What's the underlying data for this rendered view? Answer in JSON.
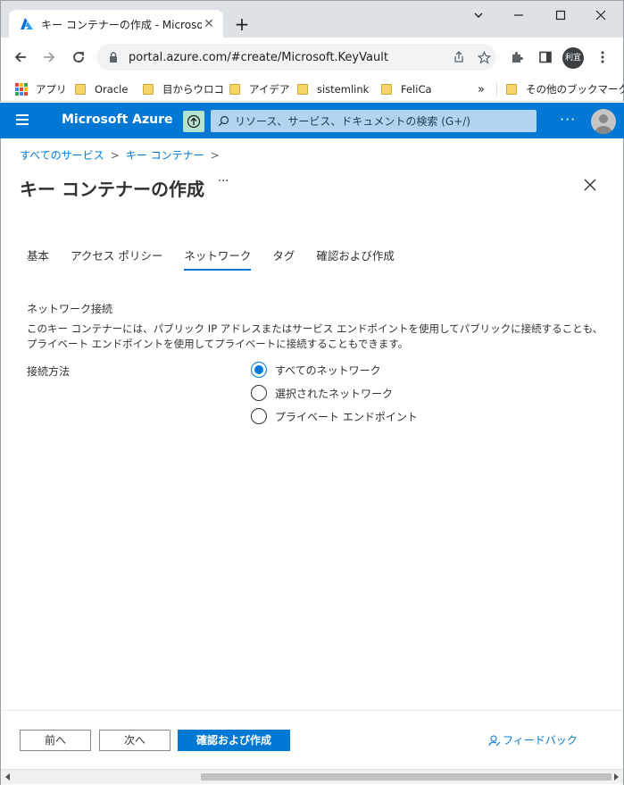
{
  "browser": {
    "tab_title": "キー コンテナーの作成 - Microsoft Az",
    "url": "portal.azure.com/#create/Microsoft.KeyVault",
    "profile_initials": "利宜",
    "bookmarks": [
      {
        "label": "アプリ",
        "icon": "apps-grid-icon"
      },
      {
        "label": "Oracle",
        "icon": "folder-icon"
      },
      {
        "label": "目からウロコ",
        "icon": "folder-icon"
      },
      {
        "label": "アイデア",
        "icon": "folder-icon"
      },
      {
        "label": "sistemlink",
        "icon": "folder-icon"
      },
      {
        "label": "FeliCa",
        "icon": "folder-icon"
      }
    ],
    "bookmarks_overflow": "»",
    "other_bookmarks": "その他のブックマーク"
  },
  "azure": {
    "brand": "Microsoft Azure",
    "search_placeholder": "リソース、サービス、ドキュメントの検索 (G+/)",
    "more": "···",
    "accent_color": "#0078d4"
  },
  "page": {
    "breadcrumb": [
      "すべてのサービス",
      "キー コンテナー"
    ],
    "title": "キー コンテナーの作成",
    "title_more": "···",
    "tabs": [
      {
        "label": "基本",
        "active": false
      },
      {
        "label": "アクセス ポリシー",
        "active": false
      },
      {
        "label": "ネットワーク",
        "active": true
      },
      {
        "label": "タグ",
        "active": false
      },
      {
        "label": "確認および作成",
        "active": false
      }
    ],
    "section_title": "ネットワーク接続",
    "description": "このキー コンテナーには、パブリック IP アドレスまたはサービス エンドポイントを使用してパブリックに接続することも、プライベート エンドポイントを使用してプライベートに接続することもできます。",
    "connection_label": "接続方法",
    "connection_options": [
      {
        "label": "すべてのネットワーク",
        "selected": true
      },
      {
        "label": "選択されたネットワーク",
        "selected": false
      },
      {
        "label": "プライベート エンドポイント",
        "selected": false
      }
    ]
  },
  "footer": {
    "prev": "前へ",
    "next": "次へ",
    "review_create": "確認および作成",
    "feedback": "フィードバック"
  }
}
